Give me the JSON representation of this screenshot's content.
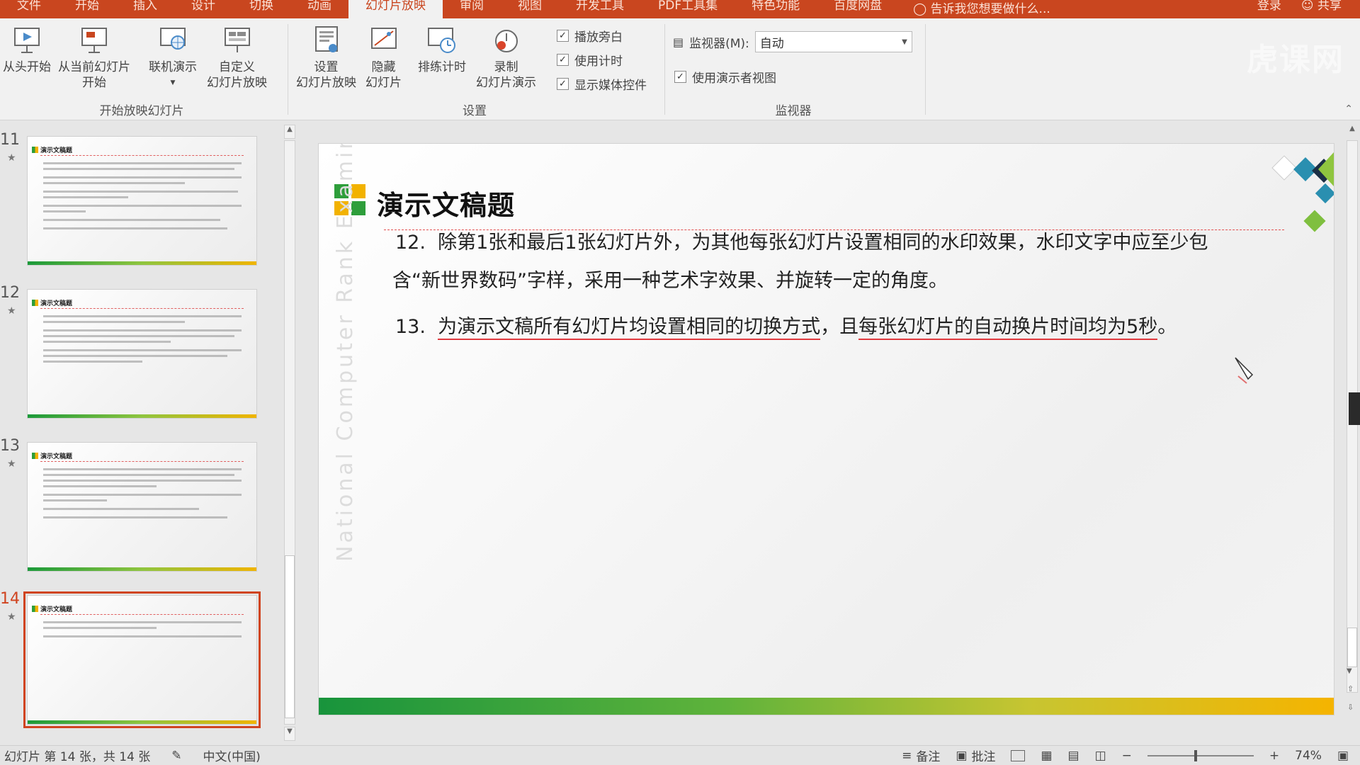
{
  "tabs": [
    "文件",
    "开始",
    "插入",
    "设计",
    "切换",
    "动画",
    "幻灯片放映",
    "审阅",
    "视图",
    "开发工具",
    "PDF工具集",
    "特色功能",
    "百度网盘"
  ],
  "active_tab_index": 6,
  "tell_me": "告诉我您想要做什么...",
  "account": {
    "login": "登录",
    "share": "共享"
  },
  "ribbon": {
    "start_group": {
      "label": "开始放映幻灯片",
      "from_beginning": "从头开始",
      "from_current_l1": "从当前幻灯片",
      "from_current_l2": "开始",
      "online_present": "联机演示",
      "custom_l1": "自定义",
      "custom_l2": "幻灯片放映"
    },
    "setup_group": {
      "label": "设置",
      "setup_l1": "设置",
      "setup_l2": "幻灯片放映",
      "hide_l1": "隐藏",
      "hide_l2": "幻灯片",
      "rehearse": "排练计时",
      "record_l1": "录制",
      "record_l2": "幻灯片演示",
      "play_narrations": "播放旁白",
      "use_timings": "使用计时",
      "show_media_controls": "显示媒体控件"
    },
    "monitor_group": {
      "label": "监视器",
      "monitor_label": "监视器(M):",
      "monitor_value": "自动",
      "use_presenter_view": "使用演示者视图"
    }
  },
  "watermark": "虎课网",
  "thumbnails": [
    {
      "number": "11",
      "title": "演示文稿题"
    },
    {
      "number": "12",
      "title": "演示文稿题"
    },
    {
      "number": "13",
      "title": "演示文稿题"
    },
    {
      "number": "14",
      "title": "演示文稿题"
    }
  ],
  "slide": {
    "title": "演示文稿题",
    "side_text": "National Computer Rank Examination",
    "item12_num": "12.",
    "item12_line1": "除第1张和最后1张幻灯片外，为其他每张幻灯片设置相同的水印效果，水印文字中应至少包",
    "item12_line2": "含“新世界数码”字样，采用一种艺术字效果、并旋转一定的角度。",
    "item13_num": "13.",
    "item13_part1": "为演示文稿所有幻灯片均设置相同的切换方式",
    "item13_sep": "，且",
    "item13_part2": "每张幻灯片的自动换片时间均为5秒",
    "item13_end": "。"
  },
  "status": {
    "slide_info": "幻灯片 第 14 张，共 14 张",
    "language": "中文(中国)",
    "notes": "备注",
    "comments": "批注",
    "zoom": "74%"
  }
}
